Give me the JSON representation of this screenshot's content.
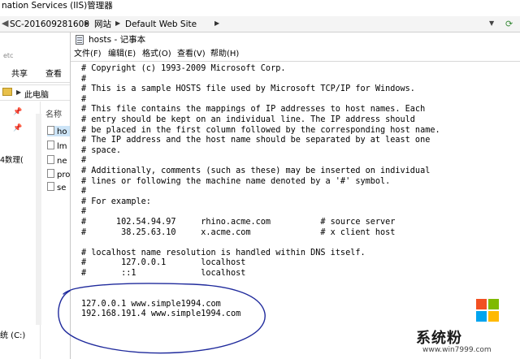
{
  "iis": {
    "title": "nation Services (IIS)管理器",
    "menu_ghost": "帮助(H)",
    "breadcrumbs": [
      "SC-201609281608",
      "网站",
      "Default Web Site"
    ]
  },
  "explorer": {
    "etc_label": "etc",
    "ribbon_tabs": [
      "共享",
      "查看"
    ],
    "path_label": "此电脑",
    "column_header": "名称",
    "side_label": "4数理(",
    "files": [
      "ho",
      "lm",
      "ne",
      "pro",
      "se"
    ],
    "drive_label": "统 (C:)"
  },
  "notepad": {
    "title": "hosts - 记事本",
    "menu": [
      "文件(F)",
      "编辑(E)",
      "格式(O)",
      "查看(V)",
      "帮助(H)"
    ],
    "lines": [
      "# Copyright (c) 1993-2009 Microsoft Corp.",
      "#",
      "# This is a sample HOSTS file used by Microsoft TCP/IP for Windows.",
      "#",
      "# This file contains the mappings of IP addresses to host names. Each",
      "# entry should be kept on an individual line. The IP address should",
      "# be placed in the first column followed by the corresponding host name.",
      "# The IP address and the host name should be separated by at least one",
      "# space.",
      "#",
      "# Additionally, comments (such as these) may be inserted on individual",
      "# lines or following the machine name denoted by a '#' symbol.",
      "#",
      "# For example:",
      "#",
      "#      102.54.94.97     rhino.acme.com          # source server",
      "#       38.25.63.10     x.acme.com              # x client host",
      "",
      "# localhost name resolution is handled within DNS itself.",
      "#       127.0.0.1       localhost",
      "#       ::1             localhost",
      "",
      "",
      "127.0.0.1 www.simple1994.com",
      "192.168.191.4 www.simple1994.com"
    ]
  },
  "watermark": {
    "brand": "系统粉",
    "url": "www.win7999.com",
    "colors": [
      "#f25022",
      "#7fba00",
      "#00a4ef",
      "#ffb900"
    ]
  },
  "annotation_color": "#1f2a9c"
}
